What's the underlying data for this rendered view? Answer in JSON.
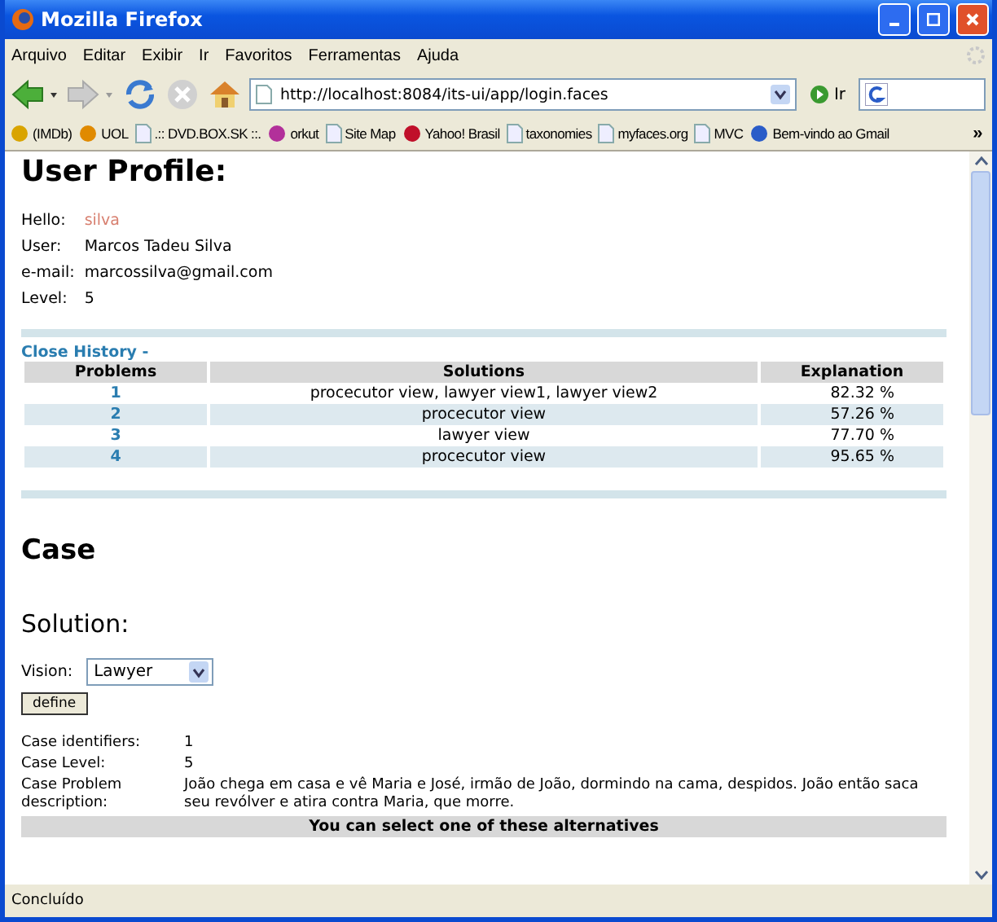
{
  "window": {
    "title": "Mozilla Firefox"
  },
  "menu": [
    "Arquivo",
    "Editar",
    "Exibir",
    "Ir",
    "Favoritos",
    "Ferramentas",
    "Ajuda"
  ],
  "toolbar": {
    "url": "http://localhost:8084/its-ui/app/login.faces",
    "go": "Ir"
  },
  "bookmarks": [
    {
      "label": "(IMDb)",
      "kind": "imdb"
    },
    {
      "label": "UOL",
      "kind": "uol"
    },
    {
      "label": ".:: DVD.BOX.SK ::.",
      "kind": "page"
    },
    {
      "label": "orkut",
      "kind": "orkut"
    },
    {
      "label": "Site Map",
      "kind": "page"
    },
    {
      "label": "Yahoo! Brasil",
      "kind": "yahoo"
    },
    {
      "label": "taxonomies",
      "kind": "page"
    },
    {
      "label": "myfaces.org",
      "kind": "page"
    },
    {
      "label": "MVC",
      "kind": "page"
    },
    {
      "label": "Bem-vindo ao Gmail",
      "kind": "google"
    }
  ],
  "bookmarks_more": "»",
  "page": {
    "heading": "User Profile:",
    "profile": [
      {
        "label": "Hello:",
        "value": "silva",
        "kind": "link"
      },
      {
        "label": "User:",
        "value": "Marcos Tadeu Silva",
        "kind": "text"
      },
      {
        "label": "e-mail:",
        "value": "marcossilva@gmail.com",
        "kind": "text"
      },
      {
        "label": "Level:",
        "value": "5",
        "kind": "text"
      }
    ],
    "history_toggle": "Close History -",
    "history": {
      "columns": [
        "Problems",
        "Solutions",
        "Explanation"
      ],
      "rows": [
        {
          "problem": "1",
          "solutions": "procecutor view, lawyer view1, lawyer view2",
          "explanation": "82.32 %"
        },
        {
          "problem": "2",
          "solutions": "procecutor view",
          "explanation": "57.26 %"
        },
        {
          "problem": "3",
          "solutions": "lawyer view",
          "explanation": "77.70 %"
        },
        {
          "problem": "4",
          "solutions": "procecutor view",
          "explanation": "95.65 %"
        }
      ]
    },
    "case_heading": "Case",
    "solution_heading": "Solution:",
    "vision": {
      "label": "Vision:",
      "value": "Lawyer"
    },
    "define_button": "define",
    "case_fields": [
      {
        "label": "Case identifiers:",
        "value": "1"
      },
      {
        "label": "Case Level:",
        "value": "5"
      },
      {
        "label": "Case Problem description:",
        "value": "João chega em casa e vê Maria e José, irmão de João, dormindo na cama, despidos. João então saca seu revólver e atira contra Maria, que morre."
      }
    ],
    "alternatives_header": "You can select one of these alternatives"
  },
  "status_bar": "Concluído"
}
